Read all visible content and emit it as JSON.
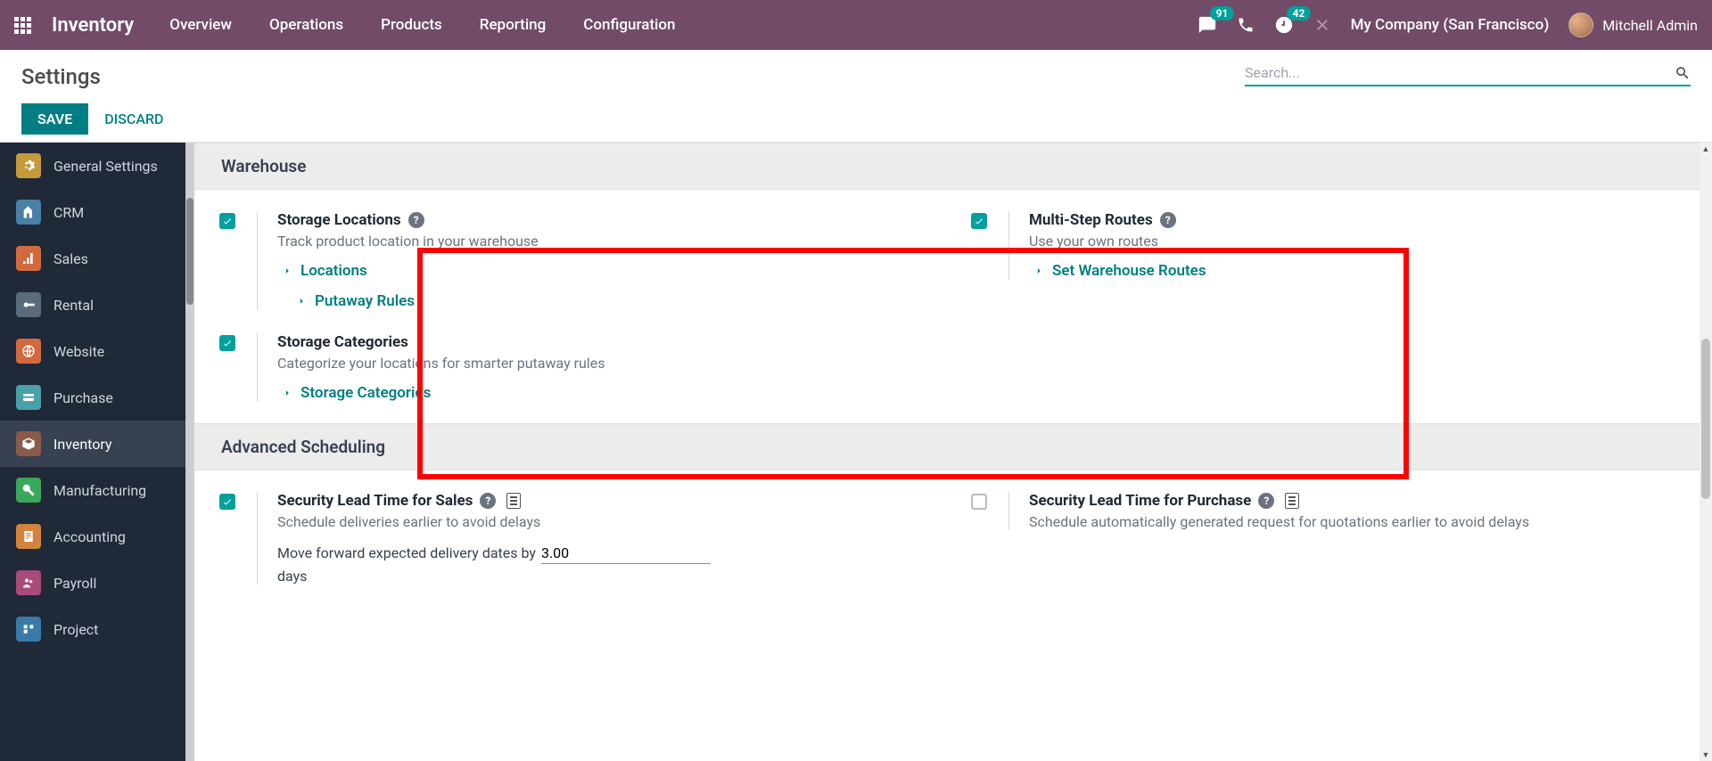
{
  "nav": {
    "brand": "Inventory",
    "links": [
      "Overview",
      "Operations",
      "Products",
      "Reporting",
      "Configuration"
    ],
    "messages_badge": "91",
    "activities_badge": "42",
    "company": "My Company (San Francisco)",
    "user": "Mitchell Admin"
  },
  "control": {
    "breadcrumb": "Settings",
    "search_placeholder": "Search...",
    "save": "SAVE",
    "discard": "DISCARD"
  },
  "sidebar": {
    "items": [
      {
        "label": "General Settings"
      },
      {
        "label": "CRM"
      },
      {
        "label": "Sales"
      },
      {
        "label": "Rental"
      },
      {
        "label": "Website"
      },
      {
        "label": "Purchase"
      },
      {
        "label": "Inventory"
      },
      {
        "label": "Manufacturing"
      },
      {
        "label": "Accounting"
      },
      {
        "label": "Payroll"
      },
      {
        "label": "Project"
      }
    ],
    "active_index": 6
  },
  "sections": {
    "warehouse": {
      "title": "Warehouse",
      "storage_locations": {
        "title": "Storage Locations",
        "desc": "Track product location in your warehouse",
        "link_locations": "Locations",
        "link_putaway": "Putaway Rules",
        "checked": true
      },
      "storage_categories": {
        "title": "Storage Categories",
        "desc": "Categorize your locations for smarter putaway rules",
        "link": "Storage Categories",
        "checked": true
      },
      "multistep": {
        "title": "Multi-Step Routes",
        "desc": "Use your own routes",
        "link": "Set Warehouse Routes",
        "checked": true
      }
    },
    "scheduling": {
      "title": "Advanced Scheduling",
      "sales_lead": {
        "title": "Security Lead Time for Sales",
        "desc": "Schedule deliveries earlier to avoid delays",
        "inline_pre": "Move forward expected delivery dates by",
        "value": "3.00",
        "inline_post": "days",
        "checked": true
      },
      "purchase_lead": {
        "title": "Security Lead Time for Purchase",
        "desc": "Schedule automatically generated request for quotations earlier to avoid delays",
        "checked": false
      }
    }
  }
}
